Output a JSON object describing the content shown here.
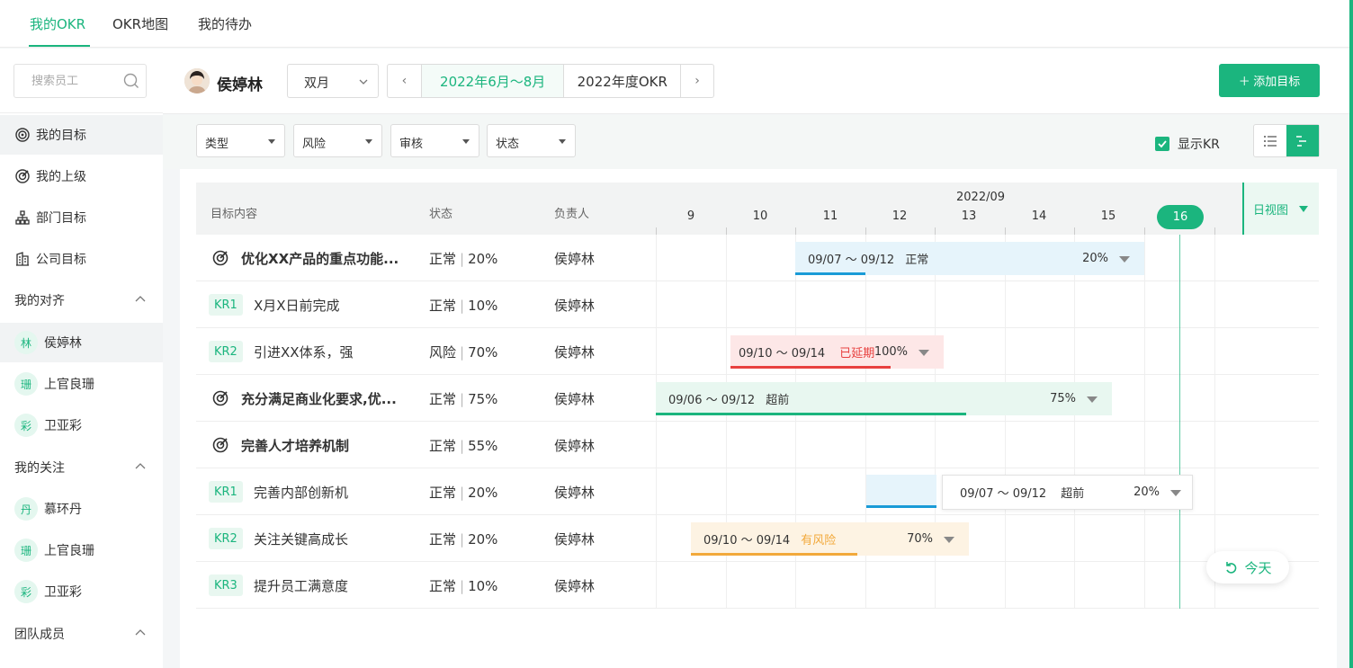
{
  "topnav": {
    "tabs": [
      "我的OKR",
      "OKR地图",
      "我的待办"
    ]
  },
  "sidebar": {
    "search_placeholder": "搜索员工",
    "items": [
      "我的目标",
      "我的上级",
      "部门目标",
      "公司目标"
    ],
    "groups": {
      "align": {
        "label": "我的对齐",
        "people": [
          {
            "initial": "林",
            "name": "侯婷林"
          },
          {
            "initial": "珊",
            "name": "上官良珊"
          },
          {
            "initial": "彩",
            "name": "卫亚彩"
          }
        ]
      },
      "follow": {
        "label": "我的关注",
        "people": [
          {
            "initial": "丹",
            "name": "慕环丹"
          },
          {
            "initial": "珊",
            "name": "上官良珊"
          },
          {
            "initial": "彩",
            "name": "卫亚彩"
          }
        ]
      },
      "team": {
        "label": "团队成员"
      }
    }
  },
  "header": {
    "user_name": "侯婷林",
    "period": "双月",
    "range_prev": "‹",
    "range_current": "2022年6月～8月",
    "range_year": "2022年度OKR",
    "range_next": "›",
    "add_button": "＋ 添加目标"
  },
  "filters": {
    "type": "类型",
    "risk": "风险",
    "review": "审核",
    "status": "状态",
    "show_kr": "显示KR"
  },
  "table": {
    "headers": {
      "content": "目标内容",
      "status": "状态",
      "owner": "负责人"
    },
    "month": "2022/09",
    "days": [
      "9",
      "10",
      "11",
      "12",
      "13",
      "14",
      "15",
      "16"
    ],
    "day_view": "日视图",
    "rows": [
      {
        "kind": "objective",
        "tag": "",
        "title": "优化XX产品的重点功能...",
        "status": "正常",
        "percent": "20%",
        "owner": "侯婷林"
      },
      {
        "kind": "kr",
        "tag": "KR1",
        "title": "X月X日前完成",
        "status": "正常",
        "percent": "10%",
        "owner": "侯婷林"
      },
      {
        "kind": "kr",
        "tag": "KR2",
        "title": "引进XX体系，强",
        "status": "风险",
        "percent": "70%",
        "owner": "侯婷林"
      },
      {
        "kind": "objective",
        "tag": "",
        "title": "充分满足商业化要求,优...",
        "status": "正常",
        "percent": "75%",
        "owner": "侯婷林"
      },
      {
        "kind": "objective",
        "tag": "",
        "title": "完善人才培养机制",
        "status": "正常",
        "percent": "55%",
        "owner": "侯婷林"
      },
      {
        "kind": "kr",
        "tag": "KR1",
        "title": "完善内部创新机",
        "status": "正常",
        "percent": "20%",
        "owner": "侯婷林"
      },
      {
        "kind": "kr",
        "tag": "KR2",
        "title": "关注关键高成长",
        "status": "正常",
        "percent": "20%",
        "owner": "侯婷林"
      },
      {
        "kind": "kr",
        "tag": "KR3",
        "title": "提升员工满意度",
        "status": "正常",
        "percent": "10%",
        "owner": "侯婷林"
      }
    ],
    "bars": [
      {
        "range": "09/07 ～ 09/12",
        "state": "正常",
        "percent": "20%",
        "progress": 0.2,
        "bg": "#e6f4fb",
        "line": "#1a9bd7",
        "state_color": "#333"
      },
      {
        "range": "09/10 ～ 09/14",
        "state": "已延期",
        "percent": "100%",
        "progress": 0.75,
        "bg": "#fde7e7",
        "line": "#e8403f",
        "state_color": "#e8403f"
      },
      {
        "range": "09/06 ～ 09/12",
        "state": "超前",
        "percent": "75%",
        "progress": 0.68,
        "bg": "#e8f7f0",
        "line": "#1bb57e",
        "state_color": "#333"
      },
      {
        "range": "09/07 ～ 09/12",
        "state": "超前",
        "percent": "20%",
        "progress": 0.2,
        "bg": "#e6f4fb",
        "line": "#1a9bd7",
        "state_color": "#333"
      },
      {
        "range": "09/10 ～ 09/14",
        "state": "有风险",
        "percent": "70%",
        "progress": 0.6,
        "bg": "#fdf3e3",
        "line": "#f2a93b",
        "state_color": "#f2a93b"
      }
    ]
  },
  "today_button": "今天"
}
